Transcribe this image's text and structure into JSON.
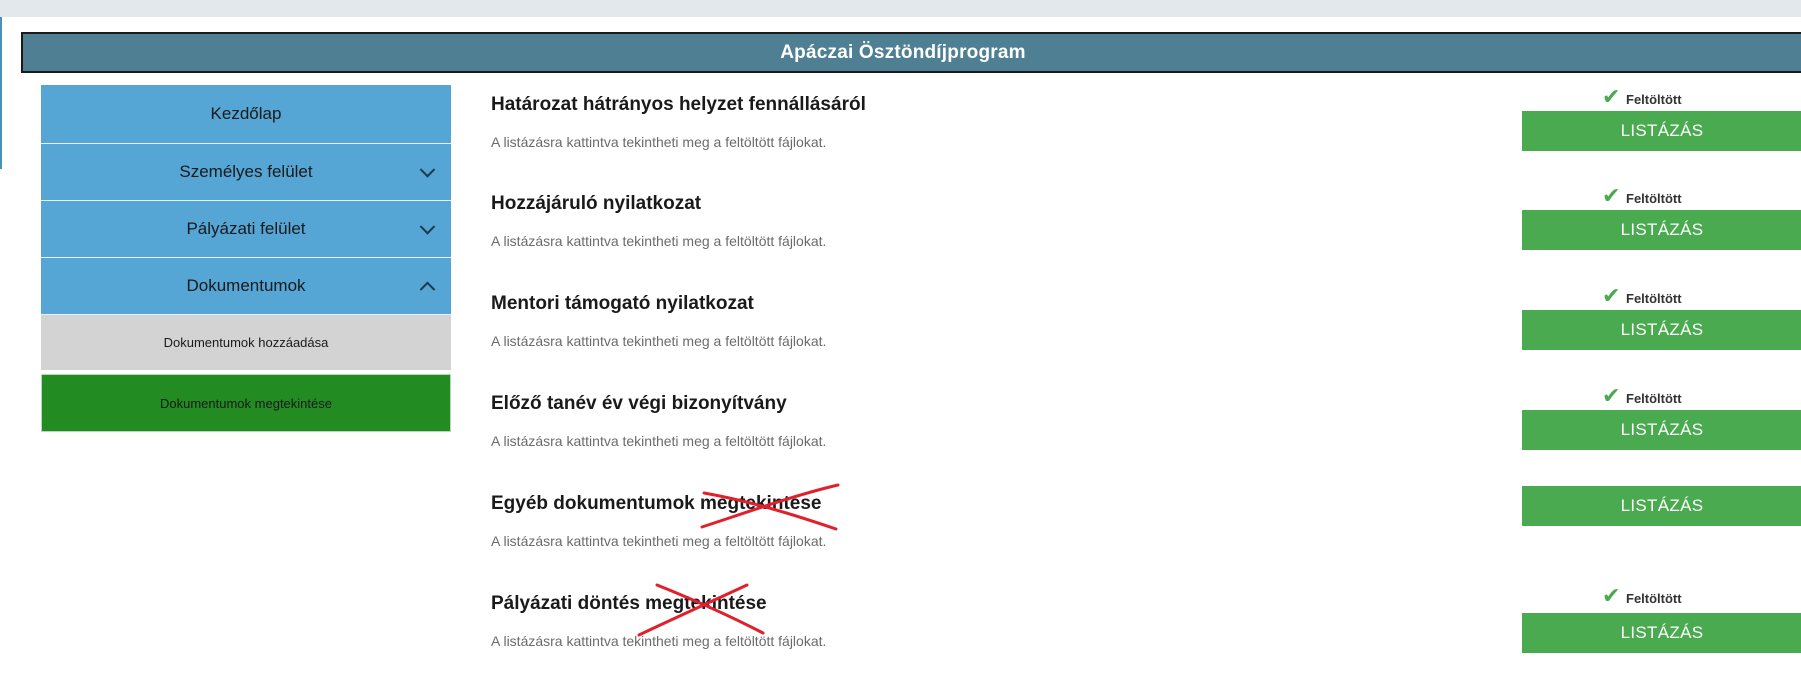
{
  "app": {
    "title": "Apáczai Ösztöndíjprogram"
  },
  "sidebar": {
    "items": [
      {
        "label": "Kezdőlap"
      },
      {
        "label": "Személyes felület"
      },
      {
        "label": "Pályázati felület"
      },
      {
        "label": "Dokumentumok"
      }
    ],
    "sub_items": [
      {
        "label": "Dokumentumok hozzáadása"
      },
      {
        "label": "Dokumentumok megtekintése",
        "active": true
      }
    ]
  },
  "documents": [
    {
      "title": "Határozat hátrányos helyzet fennállásáról",
      "description": "A listázásra kattintva tekintheti meg a feltöltött fájlokat.",
      "status": "Feltöltött",
      "button": "LISTÁZÁS"
    },
    {
      "title": "Hozzájáruló nyilatkozat",
      "description": "A listázásra kattintva tekintheti meg a feltöltött fájlokat.",
      "status": "Feltöltött",
      "button": "LISTÁZÁS"
    },
    {
      "title": "Mentori támogató nyilatkozat",
      "description": "A listázásra kattintva tekintheti meg a feltöltött fájlokat.",
      "status": "Feltöltött",
      "button": "LISTÁZÁS"
    },
    {
      "title": "Előző tanév év végi bizonyítvány",
      "description": "A listázásra kattintva tekintheti meg a feltöltött fájlokat.",
      "status": "Feltöltött",
      "button": "LISTÁZÁS"
    },
    {
      "title": "Egyéb dokumentumok megtekintése",
      "description": "A listázásra kattintva tekintheti meg a feltöltött fájlokat.",
      "status": "",
      "button": "LISTÁZÁS"
    },
    {
      "title": "Pályázati döntés megtekintése",
      "description": "A listázásra kattintva tekintheti meg a feltöltött fájlokat.",
      "status": "Feltöltött",
      "button": "LISTÁZÁS"
    }
  ],
  "colors": {
    "header": "#4f7f93",
    "nav": "#55a5d5",
    "active": "#228b22",
    "button": "#4aaa4f",
    "annotation": "#e0202a"
  },
  "icons": {
    "check": "check-icon",
    "chevron": "chevron-icon",
    "annotation": "red-cross-annotation"
  }
}
